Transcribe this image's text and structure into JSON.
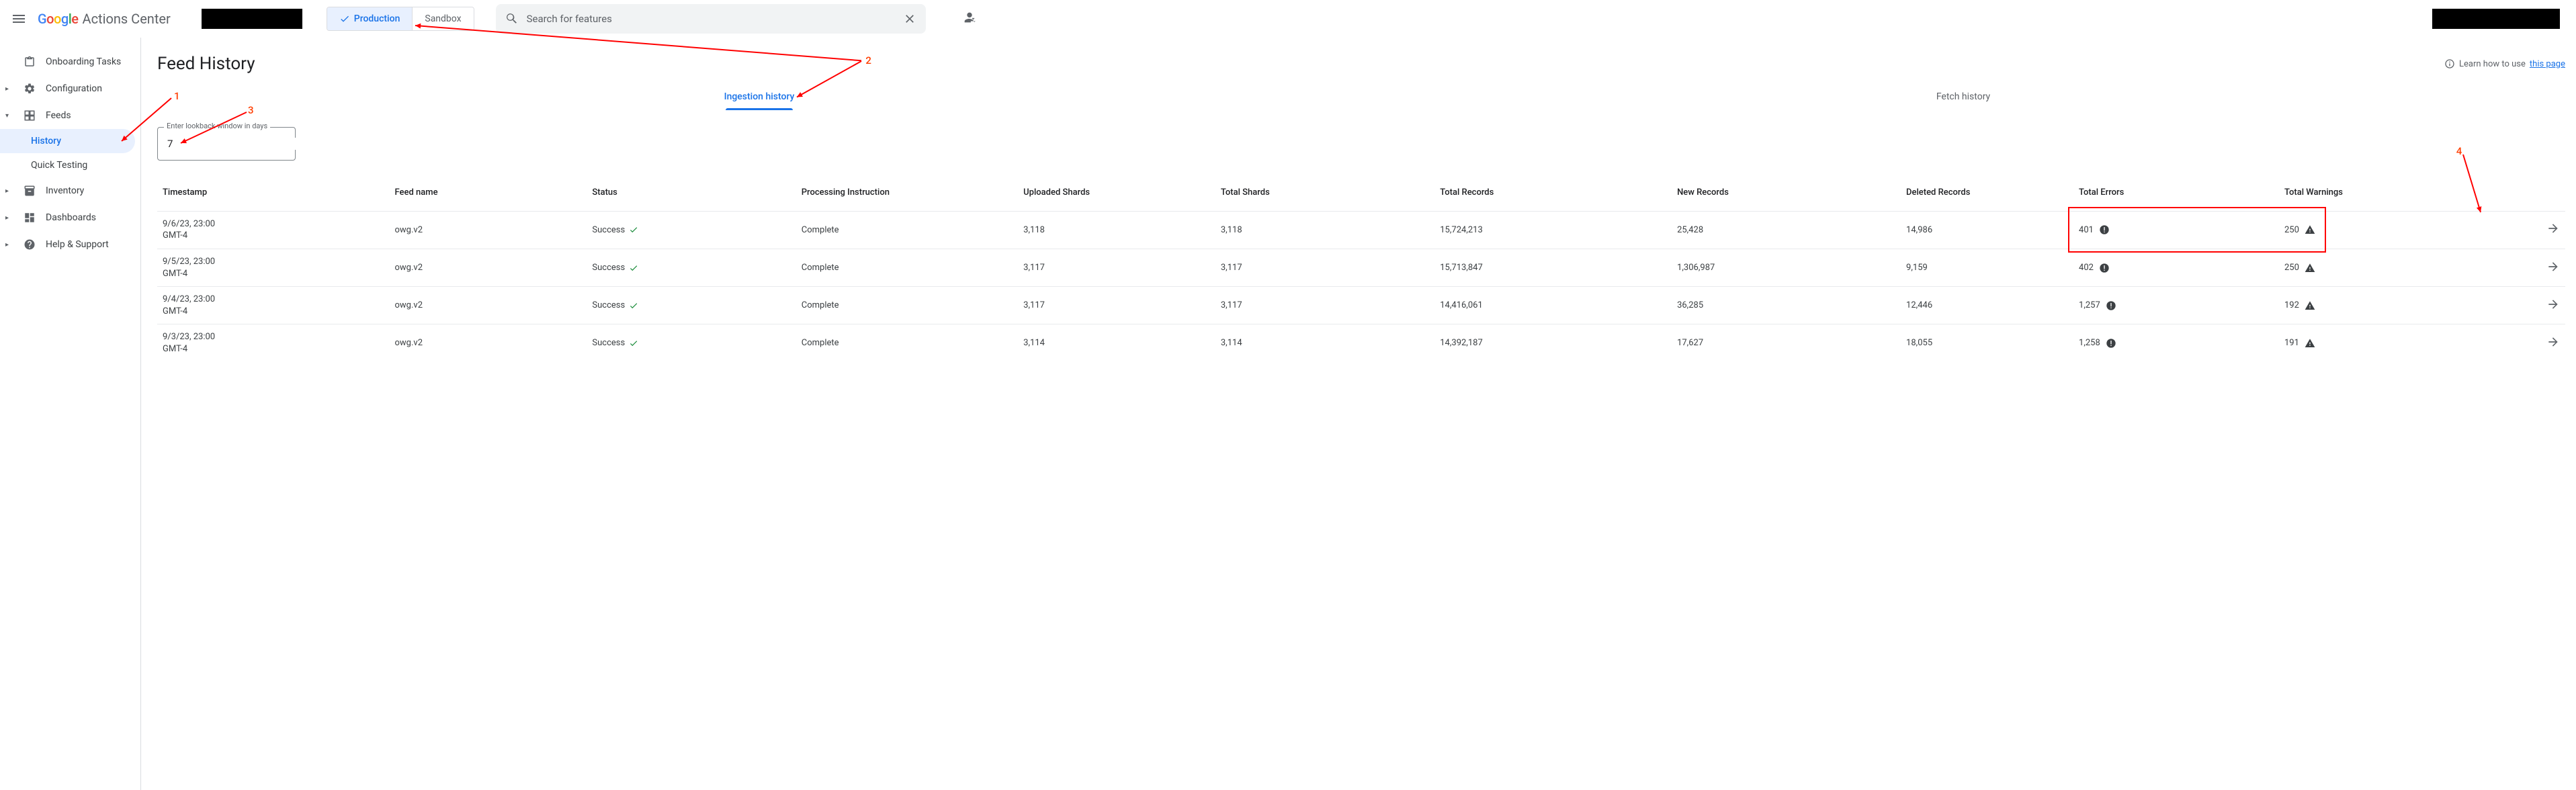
{
  "top": {
    "product_name": "Actions Center",
    "env_production": "Production",
    "env_sandbox": "Sandbox",
    "search_placeholder": "Search for features"
  },
  "sidebar": {
    "onboarding": "Onboarding Tasks",
    "configuration": "Configuration",
    "feeds": "Feeds",
    "history": "History",
    "quick_testing": "Quick Testing",
    "inventory": "Inventory",
    "dashboards": "Dashboards",
    "help": "Help & Support"
  },
  "page": {
    "title": "Feed History",
    "learn_prefix": "Learn how to use ",
    "learn_link": "this page"
  },
  "tabs": {
    "ingestion": "Ingestion history",
    "fetch": "Fetch history"
  },
  "lookback": {
    "label": "Enter lookback window in days",
    "value": "7"
  },
  "columns": {
    "c0": "Timestamp",
    "c1": "Feed name",
    "c2": "Status",
    "c3": "Processing Instruction",
    "c4": "Uploaded Shards",
    "c5": "Total Shards",
    "c6": "Total Records",
    "c7": "New Records",
    "c8": "Deleted Records",
    "c9": "Total Errors",
    "c10": "Total Warnings"
  },
  "rows": [
    {
      "ts_l1": "9/6/23, 23:00",
      "ts_l2": "GMT-4",
      "feed": "owg.v2",
      "status": "Success",
      "proc": "Complete",
      "up_sh": "3,118",
      "tot_sh": "3,118",
      "tot_rec": "15,724,213",
      "new_rec": "25,428",
      "del_rec": "14,986",
      "errs": "401",
      "warns": "250"
    },
    {
      "ts_l1": "9/5/23, 23:00",
      "ts_l2": "GMT-4",
      "feed": "owg.v2",
      "status": "Success",
      "proc": "Complete",
      "up_sh": "3,117",
      "tot_sh": "3,117",
      "tot_rec": "15,713,847",
      "new_rec": "1,306,987",
      "del_rec": "9,159",
      "errs": "402",
      "warns": "250"
    },
    {
      "ts_l1": "9/4/23, 23:00",
      "ts_l2": "GMT-4",
      "feed": "owg.v2",
      "status": "Success",
      "proc": "Complete",
      "up_sh": "3,117",
      "tot_sh": "3,117",
      "tot_rec": "14,416,061",
      "new_rec": "36,285",
      "del_rec": "12,446",
      "errs": "1,257",
      "warns": "192"
    },
    {
      "ts_l1": "9/3/23, 23:00",
      "ts_l2": "GMT-4",
      "feed": "owg.v2",
      "status": "Success",
      "proc": "Complete",
      "up_sh": "3,114",
      "tot_sh": "3,114",
      "tot_rec": "14,392,187",
      "new_rec": "17,627",
      "del_rec": "18,055",
      "errs": "1,258",
      "warns": "191"
    }
  ],
  "annotations": {
    "n1": "1",
    "n2": "2",
    "n3": "3",
    "n4": "4"
  }
}
